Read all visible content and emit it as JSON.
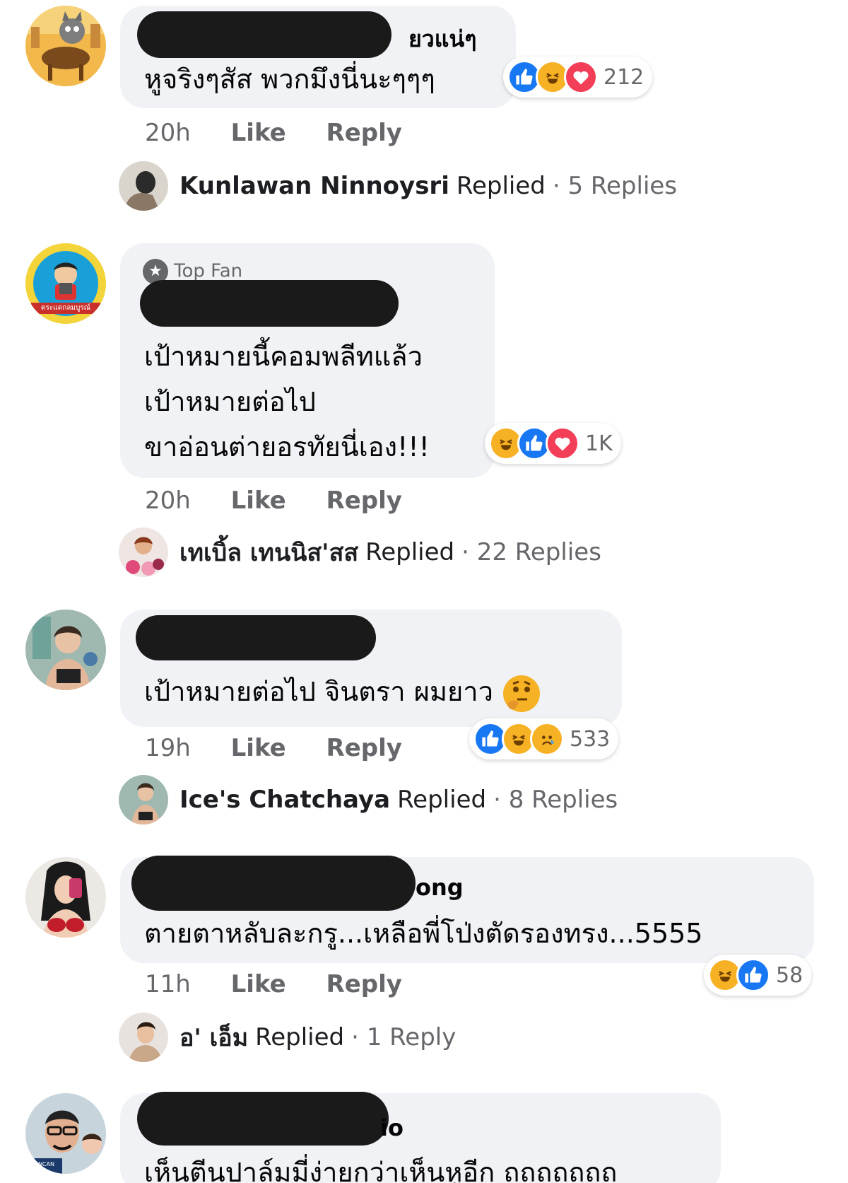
{
  "actions": {
    "like": "Like",
    "reply": "Reply",
    "replied": "Replied"
  },
  "comments": [
    {
      "name_tail": "ยวแน่ๆ",
      "lines": [
        "หูจริงๆสัส พวกมึงนี่นะๆๆๆ"
      ],
      "time": "20h",
      "reaction_icons": [
        "like-icon",
        "haha-icon",
        "love-icon"
      ],
      "reaction_count": "212",
      "reply_preview": {
        "name": "Kunlawan Ninnoysri",
        "count": "· 5 Replies"
      }
    },
    {
      "badge": "Top Fan",
      "avatar_caption": "ตระแดกลมบูรณ์",
      "lines": [
        "เป้าหมายนี้คอมพลีทแล้ว",
        "เป้าหมายต่อไป",
        "ขาอ่อนต่ายอรทัยนี่เอง!!!"
      ],
      "time": "20h",
      "reaction_icons": [
        "haha-icon",
        "like-icon",
        "love-icon"
      ],
      "reaction_count": "1K",
      "reply_preview": {
        "name": "เทเบิ้ล เทนนิส'สส",
        "count": "· 22 Replies"
      }
    },
    {
      "lines": [
        "เป้าหมายต่อไป จินตรา ผมยาว"
      ],
      "time": "19h",
      "reaction_icons": [
        "like-icon",
        "haha-icon",
        "sad-icon"
      ],
      "reaction_count": "533",
      "reply_preview": {
        "name": "Ice's Chatchaya",
        "count": "· 8 Replies"
      }
    },
    {
      "name_tail": "ong",
      "lines": [
        "ตายตาหลับละกรู...เหลือพี่โป่งตัดรองทรง...5555"
      ],
      "time": "11h",
      "reaction_icons": [
        "haha-icon",
        "like-icon"
      ],
      "reaction_count": "58",
      "reply_preview": {
        "name": "อ' เอ็ม",
        "count": "· 1 Reply"
      }
    },
    {
      "name_tail": "io",
      "avatar_caption": "CINCAN",
      "lines": [
        "เห็นตีนปาล์มมี่ง่ายกว่าเห็นหูอีก ถถถถถถถ"
      ]
    }
  ],
  "colors": {
    "bubble": "#f0f2f5",
    "like": "#1877f2",
    "haha": "#f7b125",
    "love": "#f33e58",
    "meta": "#65676b",
    "redaction": "#1a1a1a"
  }
}
